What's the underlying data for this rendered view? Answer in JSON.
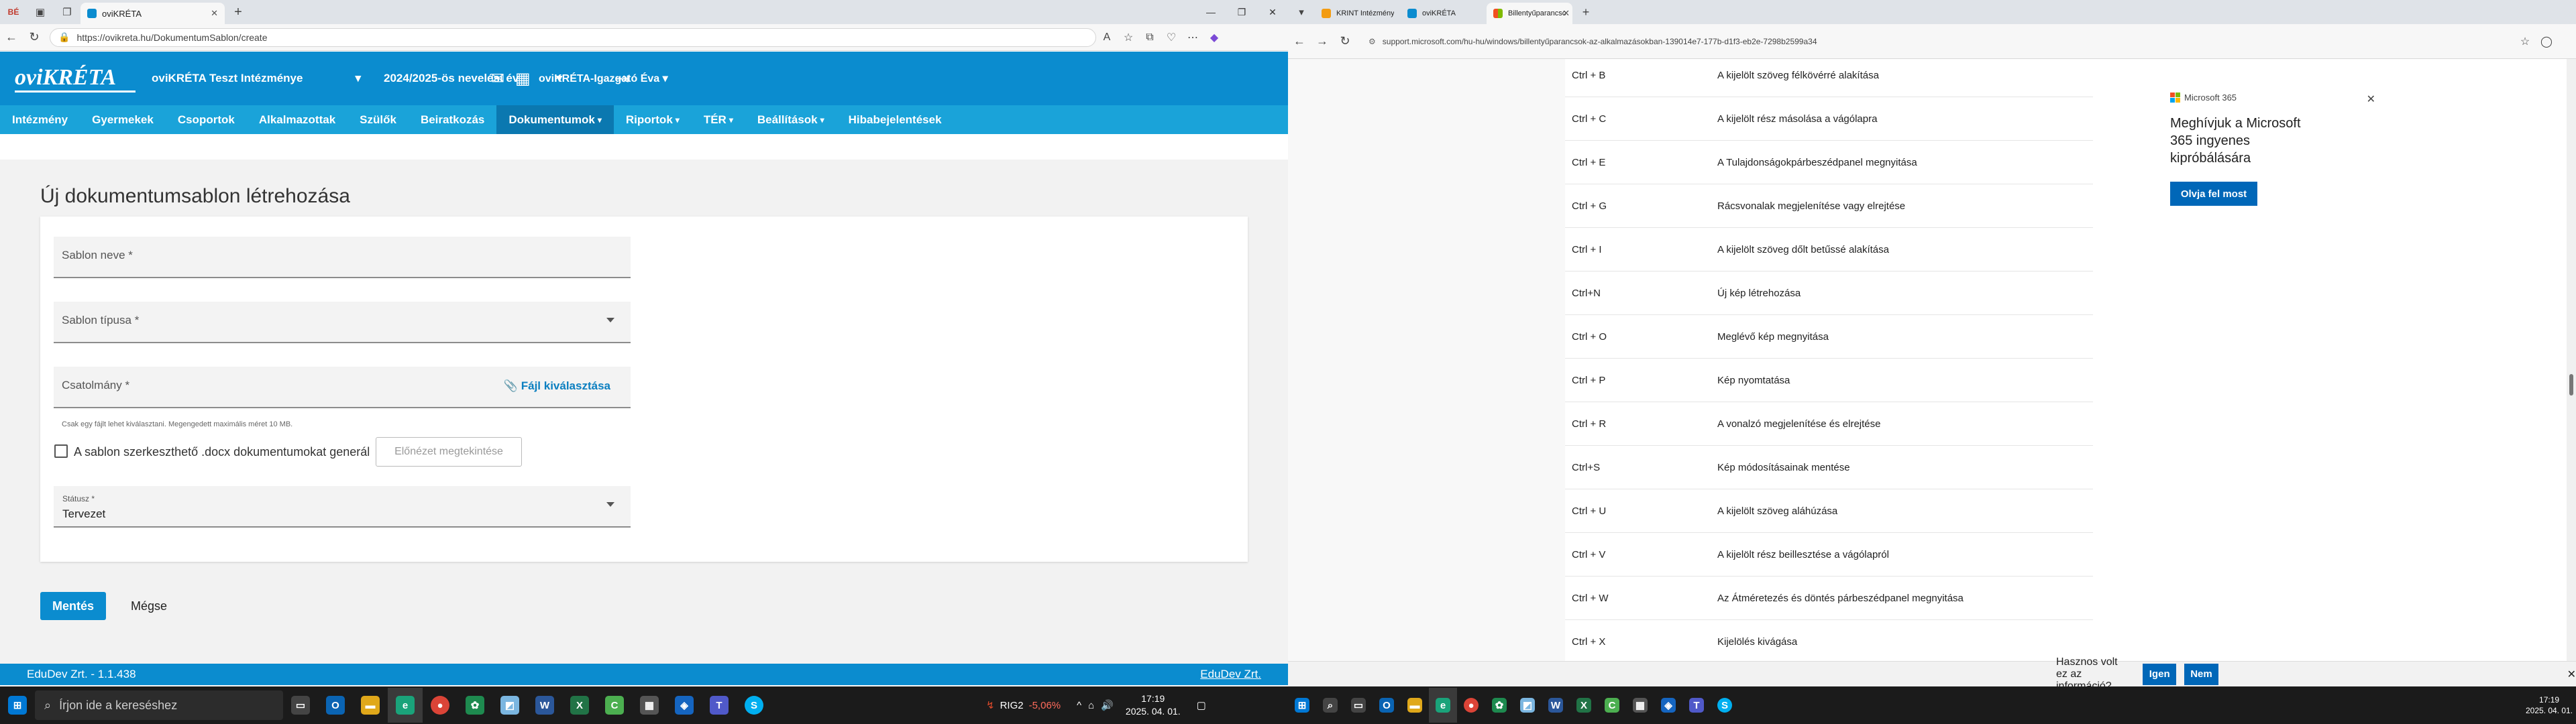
{
  "left_browser": {
    "tab_title": "oviKRÉTA",
    "url": "https://ovikreta.hu/DokumentumSablon/create",
    "app": {
      "logo": "oviKRÉTA",
      "institution": "oviKRÉTA Teszt Intézménye",
      "year": "2024/2025-ös nevelési év",
      "user": "oviKRÉTA-Igazgató Éva",
      "menu": [
        "Intézmény",
        "Gyermekek",
        "Csoportok",
        "Alkalmazottak",
        "Szülők",
        "Beiratkozás",
        "Dokumentumok",
        "Riportok",
        "TÉR",
        "Beállítások",
        "Hibabejelentések"
      ],
      "menu_dropdown_flags": [
        false,
        false,
        false,
        false,
        false,
        false,
        true,
        true,
        true,
        true,
        false
      ],
      "active_menu": "Dokumentumok"
    },
    "form": {
      "title": "Új dokumentumsablon létrehozása",
      "name_label": "Sablon neve *",
      "type_label": "Sablon típusa *",
      "attachment_label": "Csatolmány *",
      "file_pick": "Fájl kiválasztása",
      "file_hint": "Csak egy fájlt lehet kiválasztani. Megengedett maximális méret 10 MB.",
      "checkbox_label": "A sablon szerkeszthető .docx dokumentumokat generál",
      "checkbox_checked": false,
      "preview_button": "Előnézet megtekintése",
      "status_label": "Státusz *",
      "status_value": "Tervezet",
      "save_button": "Mentés",
      "cancel_button": "Mégse"
    },
    "footer_left": "EduDev Zrt. - 1.1.438",
    "footer_right": "EduDev Zrt."
  },
  "left_taskbar": {
    "search_placeholder": "Írjon ide a kereséshez",
    "stock_name": "RIG2",
    "stock_change": "-5,06%",
    "time": "17:19",
    "date": "2025. 04. 01."
  },
  "right_browser": {
    "tabs": [
      "KRINT Intézménykereső",
      "oviKRÉTA",
      "Billentyűparancsok az alkalmazásokban"
    ],
    "active_tab": 2,
    "url": "support.microsoft.com/hu-hu/windows/billentyűparancsok-az-alkalmazásokban-139014e7-177b-d1f3-eb2e-7298b2599a34",
    "shortcuts": [
      {
        "key": "Ctrl + B",
        "desc": "A kijelölt szöveg félkövérré alakítása"
      },
      {
        "key": "Ctrl + C",
        "desc": "A kijelölt rész másolása a vágólapra"
      },
      {
        "key": "Ctrl + E",
        "desc": "A Tulajdonságokpárbeszédpanel megnyitása"
      },
      {
        "key": "Ctrl + G",
        "desc": "Rácsvonalak megjelenítése vagy elrejtése"
      },
      {
        "key": "Ctrl + I",
        "desc": "A kijelölt szöveg dőlt betűssé alakítása"
      },
      {
        "key": "Ctrl+N",
        "desc": "Új kép létrehozása"
      },
      {
        "key": "Ctrl + O",
        "desc": "Meglévő kép megnyitása"
      },
      {
        "key": "Ctrl + P",
        "desc": "Kép nyomtatása"
      },
      {
        "key": "Ctrl + R",
        "desc": "A vonalzó megjelenítése és elrejtése"
      },
      {
        "key": "Ctrl+S",
        "desc": "Kép módosításainak mentése"
      },
      {
        "key": "Ctrl + U",
        "desc": "A kijelölt szöveg aláhúzása"
      },
      {
        "key": "Ctrl + V",
        "desc": "A kijelölt rész beillesztése a vágólapról"
      },
      {
        "key": "Ctrl + W",
        "desc": "Az Átméretezés és döntés párbeszédpanel megnyitása"
      },
      {
        "key": "Ctrl + X",
        "desc": "Kijelölés kivágása"
      }
    ],
    "promo": {
      "brand": "Microsoft 365",
      "message": "Meghívjuk a Microsoft 365 ingyenes kipróbálására",
      "cta": "Olvja fel most"
    },
    "feedback": {
      "question": "Hasznos volt ez az információ?",
      "yes": "Igen",
      "no": "Nem"
    }
  },
  "right_taskbar": {
    "time": "17:19",
    "date": "2025. 04. 01."
  },
  "colors": {
    "header_blue": "#0b8ccf",
    "menu_blue": "#1aa3d9",
    "ms_blue": "#0067b8"
  }
}
